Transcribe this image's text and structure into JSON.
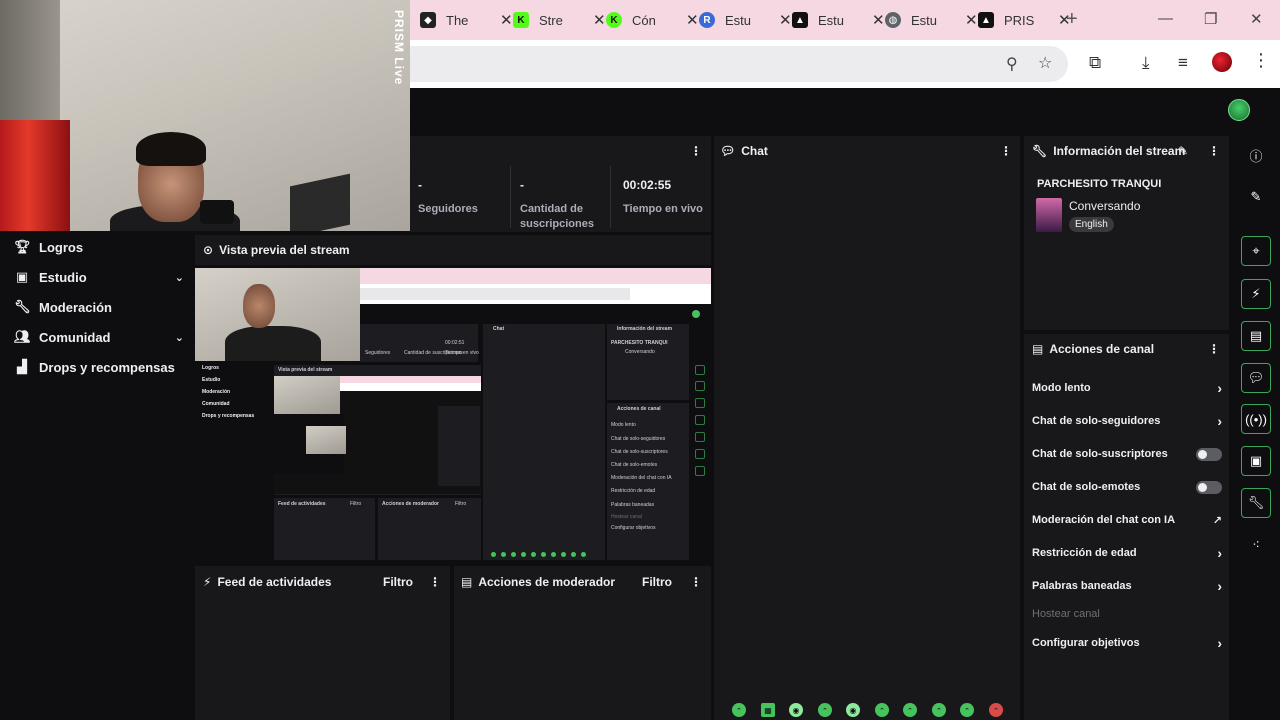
{
  "browser": {
    "tabs": [
      {
        "title": "The",
        "icon": "the-icon",
        "color": "#222222"
      },
      {
        "title": "Stre",
        "icon": "kick-icon",
        "color": "#53fc18"
      },
      {
        "title": "Cón",
        "icon": "kick-icon",
        "color": "#53fc18"
      },
      {
        "title": "Estu",
        "icon": "r-icon",
        "color": "#3a6ad8"
      },
      {
        "title": "Estu",
        "icon": "prism-icon",
        "color": "#111111"
      },
      {
        "title": "Estu",
        "icon": "globe-icon",
        "color": "#5f6368"
      },
      {
        "title": "PRIS",
        "icon": "prism-icon",
        "color": "#111111"
      }
    ],
    "new_tab": "+",
    "win_minimize": "—",
    "win_restore": "❐",
    "win_close": "✕"
  },
  "webcam": {
    "brand": "PRISM Live"
  },
  "nav": {
    "items": [
      {
        "label": "Logros",
        "icon": "trophy-icon"
      },
      {
        "label": "Estudio",
        "icon": "studio-icon",
        "expandable": true
      },
      {
        "label": "Moderación",
        "icon": "wrench-icon"
      },
      {
        "label": "Comunidad",
        "icon": "community-icon",
        "expandable": true
      },
      {
        "label": "Drops y recompensas",
        "icon": "drops-icon"
      }
    ]
  },
  "stats": {
    "followers_value": "-",
    "followers_label": "Seguidores",
    "subs_value": "-",
    "subs_label_1": "Cantidad de",
    "subs_label_2": "suscripciones",
    "live_value": "00:02:55",
    "live_label": "Tiempo en vivo"
  },
  "preview": {
    "title": "Vista previa del stream",
    "mini": {
      "nav": [
        "Logros",
        "Estudio",
        "Moderación",
        "Comunidad",
        "Drops y recompensas"
      ],
      "feed": "Feed de actividades",
      "filter": "Filtro",
      "modactions": "Acciones de moderador",
      "preview_title": "Vista previa del stream",
      "chat": "Chat",
      "info": "Información del stream",
      "channel_name": "PARCHESITO TRANQUI",
      "category": "Conversando",
      "actions_title": "Acciones de canal",
      "actions": [
        "Modo lento",
        "Chat de solo-seguidores",
        "Chat de solo-suscriptores",
        "Chat de solo-emotes",
        "Moderación del chat con IA",
        "Restricción de edad",
        "Palabras baneadas",
        "Hostear canal",
        "Configurar objetivos"
      ],
      "seguidores": "Seguidores",
      "cantidad": "Cantidad de suscripciones",
      "tiempo": "Tiempo en vivo",
      "time": "00:02:51"
    }
  },
  "feed": {
    "title": "Feed de actividades",
    "filter": "Filtro"
  },
  "modactions": {
    "title": "Acciones de moderador",
    "filter": "Filtro"
  },
  "chat": {
    "title": "Chat"
  },
  "stream_info": {
    "title": "Información del stream",
    "channel": "PARCHESITO TRANQUI",
    "category": "Conversando",
    "language": "English"
  },
  "channel_actions": {
    "title": "Acciones de canal",
    "items": [
      {
        "label": "Modo lento",
        "control": "arrow"
      },
      {
        "label": "Chat de solo-seguidores",
        "control": "arrow"
      },
      {
        "label": "Chat de solo-suscriptores",
        "control": "toggle",
        "on": false
      },
      {
        "label": "Chat de solo-emotes",
        "control": "toggle",
        "on": false
      },
      {
        "label": "Moderación del chat con IA",
        "control": "external"
      },
      {
        "label": "Restricción de edad",
        "control": "arrow"
      },
      {
        "label": "Palabras baneadas",
        "control": "arrow"
      },
      {
        "label": "Hostear canal",
        "control": "none",
        "disabled": true
      },
      {
        "label": "Configurar objetivos",
        "control": "arrow"
      }
    ]
  },
  "rail": {
    "icons": [
      "info-icon",
      "pencil-icon",
      "focus-icon",
      "bolt-icon",
      "notes-icon",
      "chat-bubble-icon",
      "broadcast-icon",
      "layout-icon",
      "wrench-icon",
      "more-icon"
    ]
  },
  "colors": {
    "accent": "#53fc18",
    "panel": "#18181b",
    "background": "#0e0e10"
  }
}
